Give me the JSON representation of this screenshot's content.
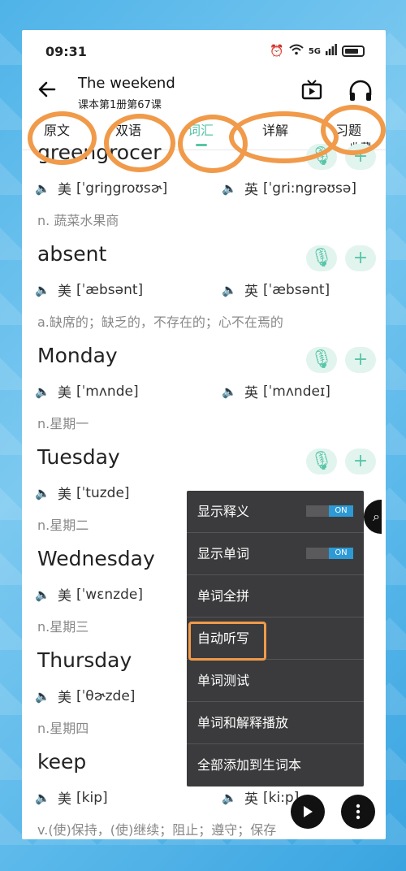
{
  "status": {
    "time": "09:31",
    "signal": "5G"
  },
  "header": {
    "title": "The weekend",
    "subtitle": "课本第1册第67课"
  },
  "tabs": [
    {
      "label": "原文"
    },
    {
      "label": "双语"
    },
    {
      "label": "词汇"
    },
    {
      "label": "详解"
    },
    {
      "label": "习题"
    }
  ],
  "tab_extra": "收藏",
  "words": [
    {
      "word": "greengrocer",
      "us_label": "美",
      "us": "[ˈgriŋgroʊsɚ]",
      "uk_label": "英",
      "uk": "[ˈgri:ngrəʊsə]",
      "meaning": "n. 蔬菜水果商"
    },
    {
      "word": "absent",
      "us_label": "美",
      "us": "[ˈæbsənt]",
      "uk_label": "英",
      "uk": "[ˈæbsənt]",
      "meaning": "a.缺席的；缺乏的，不存在的；心不在焉的"
    },
    {
      "word": "Monday",
      "us_label": "美",
      "us": "[ˈmʌnde]",
      "uk_label": "英",
      "uk": "[ˈmʌndeɪ]",
      "meaning": "n.星期一"
    },
    {
      "word": "Tuesday",
      "us_label": "美",
      "us": "[ˈtuzde]",
      "uk_label": "",
      "uk": "",
      "meaning": "n.星期二"
    },
    {
      "word": "Wednesday",
      "us_label": "美",
      "us": "[ˈwɛnzde]",
      "uk_label": "",
      "uk": "",
      "meaning": "n.星期三"
    },
    {
      "word": "Thursday",
      "us_label": "美",
      "us": "[ˈθɚzde]",
      "uk_label": "",
      "uk": "",
      "meaning": "n.星期四"
    },
    {
      "word": "keep",
      "us_label": "美",
      "us": "[kip]",
      "uk_label": "英",
      "uk": "[ki:p]",
      "meaning": "v.(使)保持，(使)继续；阻止；遵守；保存"
    }
  ],
  "menu": {
    "items": [
      {
        "label": "显示释义",
        "toggle": "ON"
      },
      {
        "label": "显示单词",
        "toggle": "ON"
      },
      {
        "label": "单词全拼"
      },
      {
        "label": "自动听写"
      },
      {
        "label": "单词测试"
      },
      {
        "label": "单词和解释播放"
      },
      {
        "label": "全部添加到生词本"
      }
    ]
  },
  "icons": {
    "back": "arrow-left-icon",
    "tv": "tv-icon",
    "headphones": "headphones-icon",
    "speaker": "speaker-icon",
    "mic": "mic-icon",
    "add": "plus-icon",
    "play": "play-icon",
    "more": "more-vertical-icon",
    "search": "search-icon"
  },
  "colors": {
    "accent": "#58c5a8",
    "annotation": "#f09a4a",
    "menu_bg": "#3b3b3d",
    "toggle_on": "#2d9ad6"
  }
}
